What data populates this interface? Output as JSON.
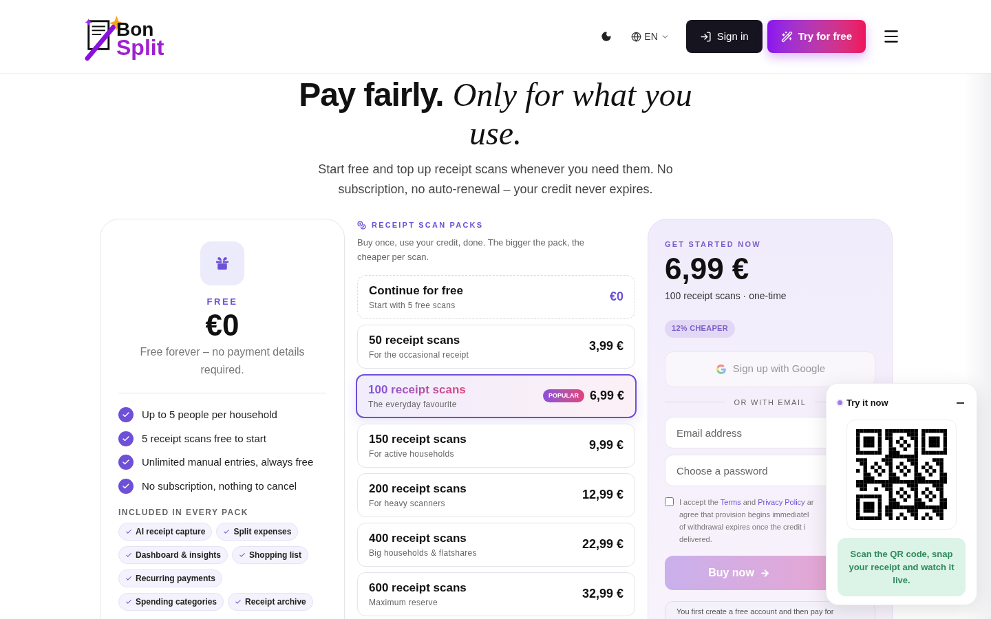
{
  "header": {
    "logo": {
      "line1": "Bon",
      "line2": "Split"
    },
    "theme_toggle": {
      "dark": false
    },
    "language": "EN",
    "sign_in": "Sign in",
    "try_free": "Try for free"
  },
  "hero": {
    "title_bold": "Pay fairly.",
    "title_italic": "Only for what you use.",
    "subtitle": "Start free and top up receipt scans whenever you need them. No subscription, no auto-renewal – your credit never expires."
  },
  "free_plan": {
    "label": "FREE",
    "price": "€0",
    "note": "Free forever – no payment details required.",
    "features": [
      "Up to 5 people per household",
      "5 receipt scans free to start",
      "Unlimited manual entries, always free",
      "No subscription, nothing to cancel"
    ],
    "included_title": "INCLUDED IN EVERY PACK",
    "included": [
      "AI receipt capture",
      "Split expenses",
      "Dashboard & insights",
      "Shopping list",
      "Recurring payments",
      "Spending categories",
      "Receipt archive"
    ]
  },
  "packs": {
    "title": "RECEIPT SCAN PACKS",
    "intro": "Buy once, use your credit, done. The bigger the pack, the cheaper per scan.",
    "items": [
      {
        "kind": "free",
        "name": "Continue for free",
        "desc": "Start with 5 free scans",
        "price": "€0",
        "selected": false
      },
      {
        "kind": "pack",
        "name": "50 receipt scans",
        "desc": "For the occasional receipt",
        "price": "3,99 €",
        "selected": false
      },
      {
        "kind": "pack",
        "name": "100 receipt scans",
        "desc": "The everyday favourite",
        "price": "6,99 €",
        "badge": "POPULAR",
        "selected": true
      },
      {
        "kind": "pack",
        "name": "150 receipt scans",
        "desc": "For active households",
        "price": "9,99 €",
        "selected": false
      },
      {
        "kind": "pack",
        "name": "200 receipt scans",
        "desc": "For heavy scanners",
        "price": "12,99 €",
        "selected": false
      },
      {
        "kind": "pack",
        "name": "400 receipt scans",
        "desc": "Big households & flatshares",
        "price": "22,99 €",
        "selected": false
      },
      {
        "kind": "pack",
        "name": "600 receipt scans",
        "desc": "Maximum reserve",
        "price": "32,99 €",
        "selected": false
      }
    ]
  },
  "checkout": {
    "label": "GET STARTED NOW",
    "price": "6,99 €",
    "summary": "100 receipt scans · one-time",
    "saving": "12% CHEAPER",
    "google": "Sign up with Google",
    "divider": "OR WITH EMAIL",
    "email_placeholder": "Email address",
    "password_placeholder": "Choose a password",
    "consent": {
      "checked": false,
      "lines": [
        [
          {
            "text": "I accept the "
          },
          {
            "text": "Terms",
            "link": true
          },
          {
            "text": " and "
          },
          {
            "text": "Privacy Policy",
            "link": true
          },
          {
            "text": " ar"
          }
        ],
        [
          {
            "text": "agree that provision begins immediatel"
          }
        ],
        [
          {
            "text": "of withdrawal expires once the credit i"
          }
        ],
        [
          {
            "text": "delivered."
          }
        ]
      ]
    },
    "buy": "Buy now",
    "footnote": "You first create a free account and then pay for"
  },
  "try_popup": {
    "title": "Try it now",
    "message": "Scan the QR code, snap your receipt and watch it live."
  }
}
